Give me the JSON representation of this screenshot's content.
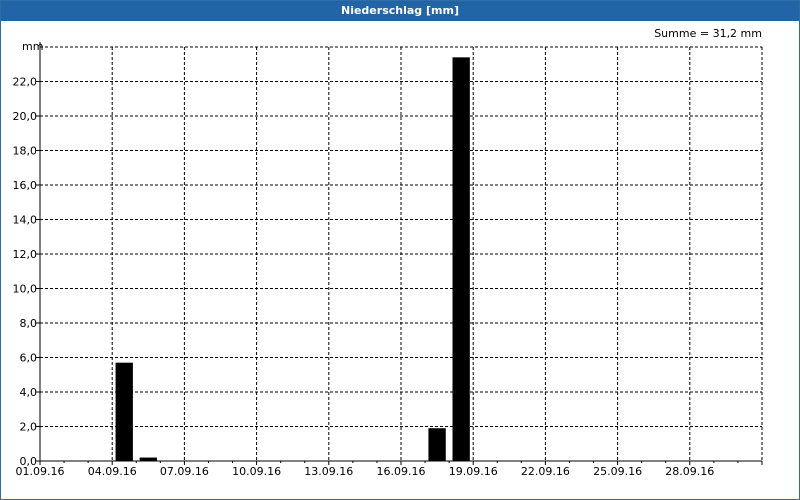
{
  "window": {
    "title": "Niederschlag [mm]"
  },
  "chart_data": {
    "type": "bar",
    "title": "Niederschlag [mm]",
    "ylabel": "mm",
    "annotation": "Summe = 31,2 mm",
    "ylim": [
      0,
      24
    ],
    "grid": true,
    "x_tick_labels": [
      "01.09.16",
      "04.09.16",
      "07.09.16",
      "10.09.16",
      "13.09.16",
      "16.09.16",
      "19.09.16",
      "22.09.16",
      "25.09.16",
      "28.09.16"
    ],
    "y_tick_labels": [
      "0,0",
      "2,0",
      "4,0",
      "6,0",
      "8,0",
      "10,0",
      "12,0",
      "14,0",
      "16,0",
      "18,0",
      "20,0",
      "22,0"
    ],
    "x": [
      "01.09.16",
      "02.09.16",
      "03.09.16",
      "04.09.16",
      "05.09.16",
      "06.09.16",
      "07.09.16",
      "08.09.16",
      "09.09.16",
      "10.09.16",
      "11.09.16",
      "12.09.16",
      "13.09.16",
      "14.09.16",
      "15.09.16",
      "16.09.16",
      "17.09.16",
      "18.09.16",
      "19.09.16",
      "20.09.16",
      "21.09.16",
      "22.09.16",
      "23.09.16",
      "24.09.16",
      "25.09.16",
      "26.09.16",
      "27.09.16",
      "28.09.16",
      "29.09.16",
      "30.09.16"
    ],
    "values": [
      0,
      0,
      0,
      5.7,
      0.2,
      0,
      0,
      0,
      0,
      0,
      0,
      0,
      0,
      0,
      0,
      0,
      1.9,
      23.4,
      0,
      0,
      0,
      0,
      0,
      0,
      0,
      0,
      0,
      0,
      0,
      0
    ],
    "bar_color": "#000000",
    "grid_color": "#000000"
  }
}
